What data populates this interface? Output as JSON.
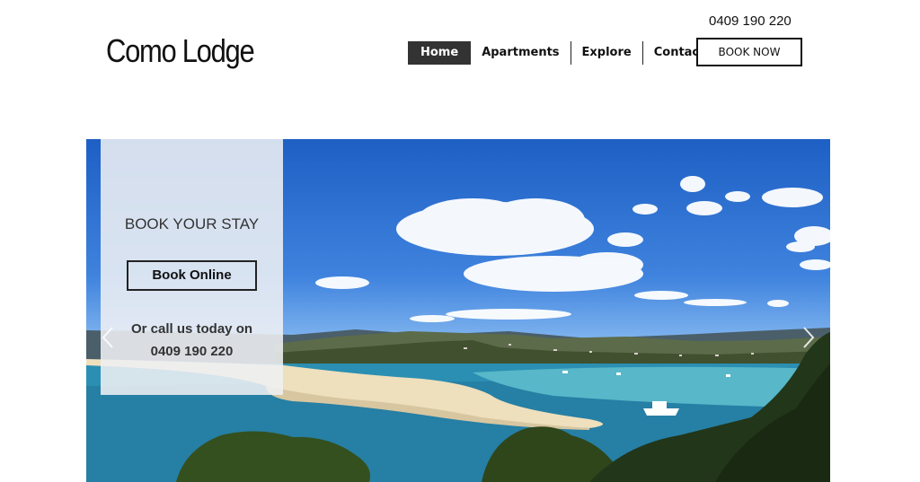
{
  "header": {
    "logo": "Como Lodge",
    "phone": "0409 190 220",
    "book_now_label": "BOOK NOW"
  },
  "nav": {
    "items": [
      {
        "label": "Home",
        "active": true
      },
      {
        "label": "Apartments",
        "active": false
      },
      {
        "label": "Explore",
        "active": false
      },
      {
        "label": "Contact",
        "active": false
      }
    ]
  },
  "hero": {
    "panel": {
      "title": "BOOK YOUR STAY",
      "button_label": "Book Online",
      "call_line1": "Or call us today on",
      "call_line2": "0409 190 220"
    },
    "prev_icon": "chevron-left-icon",
    "next_icon": "chevron-right-icon"
  },
  "colors": {
    "nav_active_bg": "#333333",
    "text": "#111111",
    "sky": "#2f6fd0",
    "water": "#2a8fb3",
    "sand": "#eedfbd"
  }
}
